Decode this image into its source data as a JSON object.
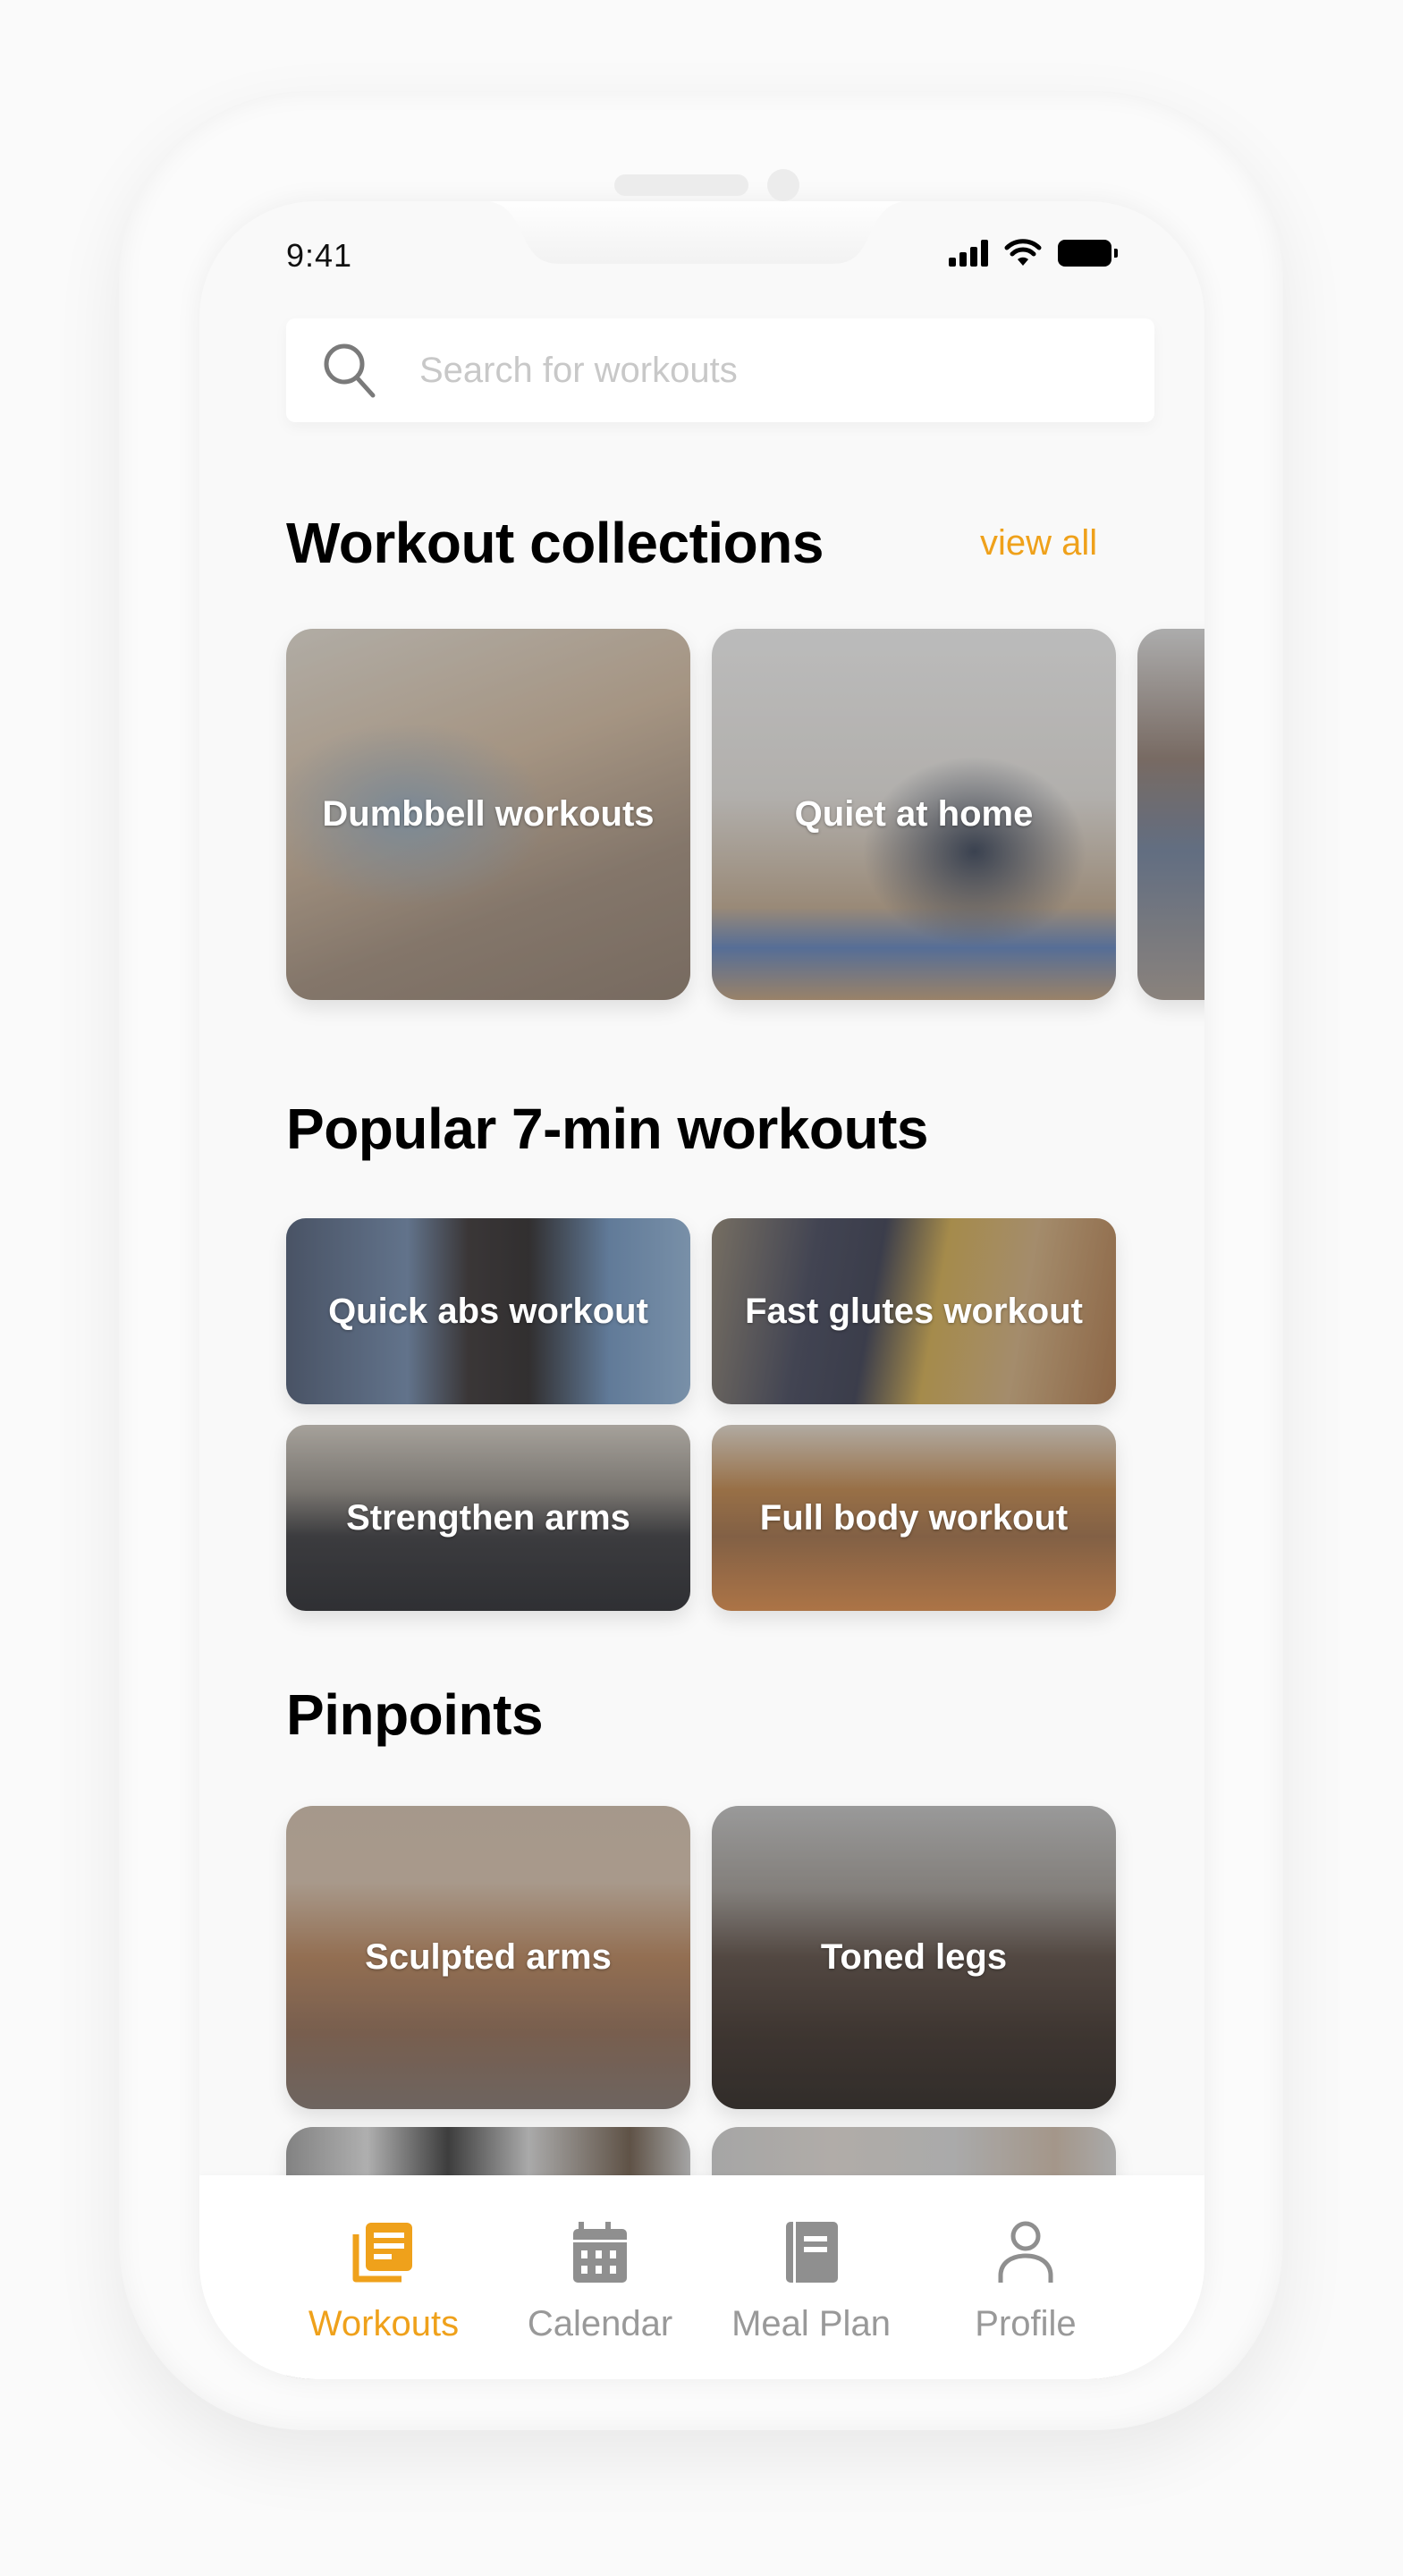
{
  "status_bar": {
    "time": "9:41",
    "icons": [
      "signal-icon",
      "wifi-icon",
      "battery-icon"
    ]
  },
  "search": {
    "placeholder": "Search for workouts",
    "value": "",
    "icon": "search-icon"
  },
  "colors": {
    "accent": "#EFA11B",
    "inactive": "#999999",
    "background": "#F9F9F9"
  },
  "sections": {
    "collections": {
      "title": "Workout collections",
      "view_all": "view all",
      "cards": [
        {
          "label": "Dumbbell workouts"
        },
        {
          "label": "Quiet at home"
        },
        {
          "label": ""
        }
      ]
    },
    "popular": {
      "title": "Popular 7-min workouts",
      "cards": [
        {
          "label": "Quick abs workout"
        },
        {
          "label": "Fast glutes workout"
        },
        {
          "label": "Strengthen arms"
        },
        {
          "label": "Full body workout"
        }
      ]
    },
    "pinpoints": {
      "title": "Pinpoints",
      "cards": [
        {
          "label": "Sculpted arms"
        },
        {
          "label": "Toned legs"
        },
        {
          "label": ""
        },
        {
          "label": ""
        }
      ]
    }
  },
  "tab_bar": {
    "active": "Workouts",
    "tabs": [
      {
        "label": "Workouts",
        "icon": "workouts-icon"
      },
      {
        "label": "Calendar",
        "icon": "calendar-icon"
      },
      {
        "label": "Meal Plan",
        "icon": "meal-plan-icon"
      },
      {
        "label": "Profile",
        "icon": "profile-icon"
      }
    ]
  }
}
